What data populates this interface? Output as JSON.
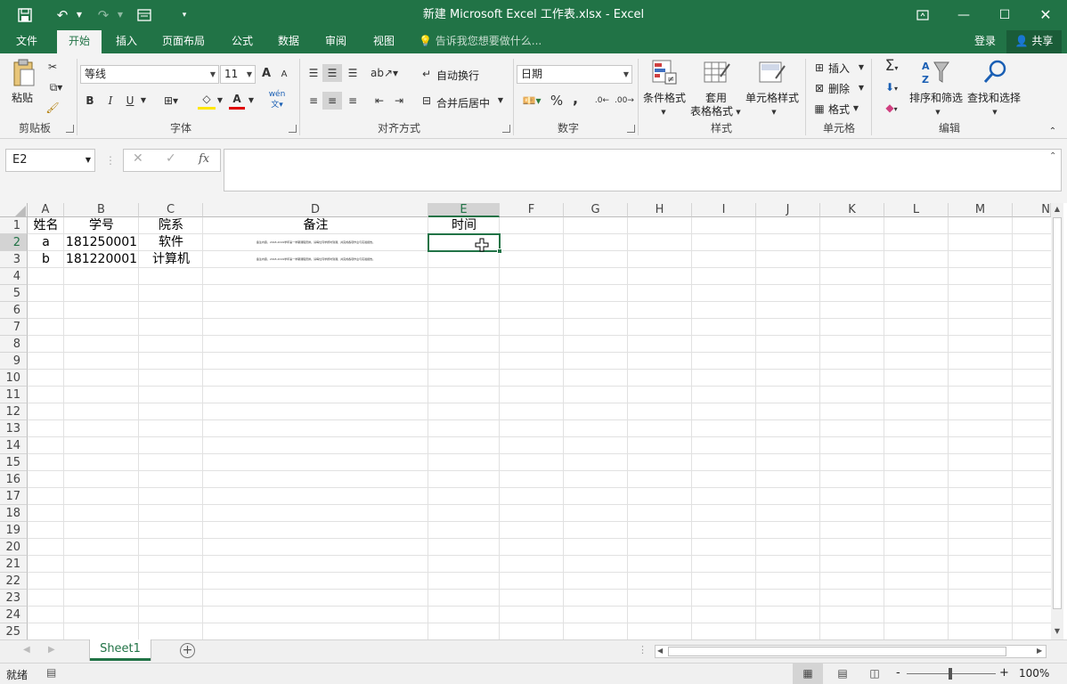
{
  "title_bar": {
    "title": "新建 Microsoft Excel 工作表.xlsx - Excel",
    "save_icon": "save-icon",
    "undo_icon": "undo-icon",
    "redo_icon": "redo-icon",
    "form_icon": "form-icon",
    "customize_icon": "customize-qat-icon"
  },
  "tabs": [
    {
      "label": "文件",
      "active": false
    },
    {
      "label": "开始",
      "active": true
    },
    {
      "label": "插入",
      "active": false
    },
    {
      "label": "页面布局",
      "active": false
    },
    {
      "label": "公式",
      "active": false
    },
    {
      "label": "数据",
      "active": false
    },
    {
      "label": "审阅",
      "active": false
    },
    {
      "label": "视图",
      "active": false
    }
  ],
  "tell_me": "告诉我您想要做什么...",
  "signin": "登录",
  "share": "共享",
  "ribbon": {
    "clipboard": {
      "label": "剪贴板",
      "paste": "粘贴"
    },
    "font": {
      "label": "字体",
      "name": "等线",
      "size": "11",
      "bold": "B",
      "italic": "I",
      "underline": "U",
      "grow": "A",
      "shrink": "A",
      "fontcolor": "A",
      "phonetic": "wén"
    },
    "alignment": {
      "label": "对齐方式",
      "wrap": "自动换行",
      "merge": "合并后居中"
    },
    "number": {
      "label": "数字",
      "format": "日期",
      "percent": "%",
      "comma": ","
    },
    "styles": {
      "label": "样式",
      "cond": "条件格式",
      "table_1": "套用",
      "table_2": "表格格式",
      "cell": "单元格样式"
    },
    "cells": {
      "label": "单元格",
      "insert": "插入",
      "delete": "删除",
      "format": "格式"
    },
    "editing": {
      "label": "编辑",
      "sort": "排序和筛选",
      "find": "查找和选择"
    }
  },
  "formula_bar": {
    "name_box": "E2",
    "cancel": "✕",
    "enter": "✓",
    "fx": "fx",
    "value": ""
  },
  "columns": [
    "A",
    "B",
    "C",
    "D",
    "E",
    "F",
    "G",
    "H",
    "I",
    "J",
    "K",
    "L",
    "M",
    "N"
  ],
  "rows": [
    "1",
    "2",
    "3",
    "4",
    "5",
    "6",
    "7",
    "8",
    "9",
    "10",
    "11",
    "12",
    "13",
    "14",
    "15",
    "16",
    "17",
    "18",
    "19",
    "20",
    "21",
    "22",
    "23",
    "24",
    "25"
  ],
  "cells": {
    "headers": [
      "姓名",
      "学号",
      "院系",
      "备注",
      "时间"
    ],
    "row2": [
      "a",
      "181250001",
      "软件",
      "备注内容，2018-2019学年第一学期课程安排。请每位同学按时到课，并完成各项作业与实验报告。"
    ],
    "row3": [
      "b",
      "181220001",
      "计算机",
      "备注内容，2018-2019学年第一学期课程安排。请每位同学按时到课，并完成各项作业与实验报告。"
    ]
  },
  "selected_cell": "E2",
  "sheet_tabs": [
    "Sheet1"
  ],
  "status": {
    "ready": "就绪",
    "zoom": "100%",
    "minus": "-",
    "plus": "+"
  },
  "colors": {
    "brand": "#217346",
    "ribbon": "#f3f3f3"
  }
}
